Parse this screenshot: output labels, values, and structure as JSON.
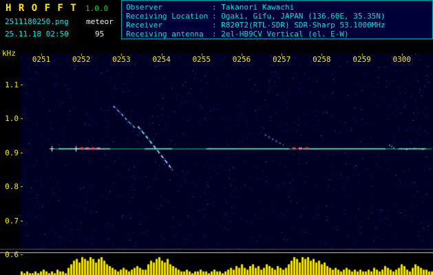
{
  "app": {
    "title": "H R O F F T",
    "version": "1.0.0",
    "filename": "2511180250.png",
    "mode": "meteor",
    "datetime": "25.11.18 02:50",
    "count": "95"
  },
  "station": {
    "rows": [
      {
        "label": "Observer",
        "value": ": Takanori Kawachi"
      },
      {
        "label": "Receiving Location",
        "value": ": Ogaki, Gifu, JAPAN (136.60E, 35.35N)"
      },
      {
        "label": "Receiver",
        "value": ": R820T2(RTL-SDR) SDR-Sharp 53.1000MHz"
      },
      {
        "label": "Receiving antenna",
        "value": ": 2el-HB9CV Vertical (el. E-W)"
      }
    ]
  },
  "chart_data": {
    "type": "heatmap",
    "subtype": "radio-meteor-spectrogram",
    "x_axis": {
      "start": "0250",
      "end": "0300",
      "unit": "HHMM",
      "minutes_span": 10,
      "ticks": [
        "0251",
        "0252",
        "0253",
        "0254",
        "0255",
        "0256",
        "0257",
        "0258",
        "0259",
        "0300"
      ]
    },
    "y_axis": {
      "label": "kHz",
      "ticks": [
        "1.1",
        "1.0",
        "0.9",
        "0.8",
        "0.7",
        "0.6"
      ],
      "range_khz": [
        0.6,
        1.19
      ]
    },
    "carrier": {
      "freq_khz": 0.911,
      "t_start_min": 1.2,
      "t_end_min": 10.75,
      "color": "#00cc99",
      "bright_color": "#7dffd8",
      "bright_segments_t": [
        [
          1.43,
          2.72
        ],
        [
          3.58,
          4.27
        ],
        [
          5.12,
          7.19
        ],
        [
          7.53,
          9.59
        ],
        [
          9.93,
          10.6
        ]
      ],
      "hotspots": [
        {
          "t": 2.0,
          "color": "#ff4060"
        },
        {
          "t": 2.14,
          "color": "#ff70a0"
        },
        {
          "t": 2.28,
          "color": "#ff4060"
        },
        {
          "t": 2.42,
          "color": "#ff70a0"
        },
        {
          "t": 7.3,
          "color": "#ff4060"
        },
        {
          "t": 7.46,
          "color": "#ff70a0"
        },
        {
          "t": 7.62,
          "color": "#ff4060"
        }
      ],
      "marker_crosses_t": [
        1.26,
        1.86
      ]
    },
    "meteor_echoes": [
      {
        "name": "head-arc",
        "style": "dashed",
        "color": "#79c9ff",
        "points_t_khz": [
          [
            2.8,
            1.036
          ],
          [
            2.92,
            1.022
          ],
          [
            3.04,
            1.008
          ],
          [
            3.16,
            0.992
          ],
          [
            3.27,
            0.98
          ],
          [
            3.35,
            0.97
          ]
        ]
      },
      {
        "name": "main-descending-echo",
        "style": "dashed",
        "color": "#9fe0ff",
        "points_t_khz": [
          [
            3.41,
            0.976
          ],
          [
            3.54,
            0.958
          ],
          [
            3.68,
            0.938
          ],
          [
            3.82,
            0.917
          ],
          [
            3.94,
            0.899
          ],
          [
            4.06,
            0.881
          ],
          [
            4.18,
            0.863
          ],
          [
            4.28,
            0.847
          ]
        ]
      },
      {
        "name": "faint-echo",
        "style": "dotted",
        "color": "#5599dd",
        "points_t_khz": [
          [
            6.58,
            0.952
          ],
          [
            6.74,
            0.941
          ],
          [
            6.89,
            0.931
          ],
          [
            7.05,
            0.921
          ]
        ]
      }
    ],
    "sporadic_dots_t_khz": [
      [
        9.68,
        0.922
      ],
      [
        9.73,
        0.918
      ],
      [
        9.78,
        0.914
      ],
      [
        9.9,
        0.911
      ],
      [
        10.1,
        0.909
      ],
      [
        10.3,
        0.912
      ],
      [
        10.5,
        0.91
      ]
    ],
    "level_histogram": {
      "color": "#f5e400",
      "threshold_line": true,
      "values_0_10": [
        2,
        1,
        2,
        1,
        1,
        2,
        1,
        2,
        3,
        2,
        1,
        2,
        1,
        3,
        2,
        2,
        1,
        4,
        6,
        8,
        9,
        7,
        10,
        9,
        8,
        10,
        9,
        7,
        9,
        10,
        8,
        6,
        5,
        4,
        3,
        2,
        3,
        4,
        3,
        2,
        3,
        4,
        5,
        4,
        3,
        3,
        6,
        8,
        7,
        9,
        10,
        8,
        7,
        9,
        6,
        5,
        4,
        3,
        2,
        2,
        3,
        2,
        1,
        2,
        2,
        3,
        2,
        2,
        1,
        2,
        3,
        2,
        2,
        1,
        2,
        3,
        4,
        3,
        5,
        4,
        6,
        4,
        3,
        5,
        6,
        4,
        5,
        3,
        4,
        6,
        5,
        4,
        3,
        5,
        4,
        3,
        4,
        6,
        8,
        10,
        9,
        7,
        10,
        9,
        10,
        8,
        9,
        7,
        8,
        6,
        7,
        5,
        4,
        3,
        4,
        3,
        2,
        3,
        4,
        3,
        2,
        3,
        2,
        3,
        2,
        2,
        3,
        2,
        4,
        3,
        2,
        3,
        5,
        4,
        3,
        2,
        3,
        4,
        6,
        5,
        3,
        2,
        4,
        6,
        5,
        4,
        3,
        3,
        2,
        2
      ]
    }
  }
}
